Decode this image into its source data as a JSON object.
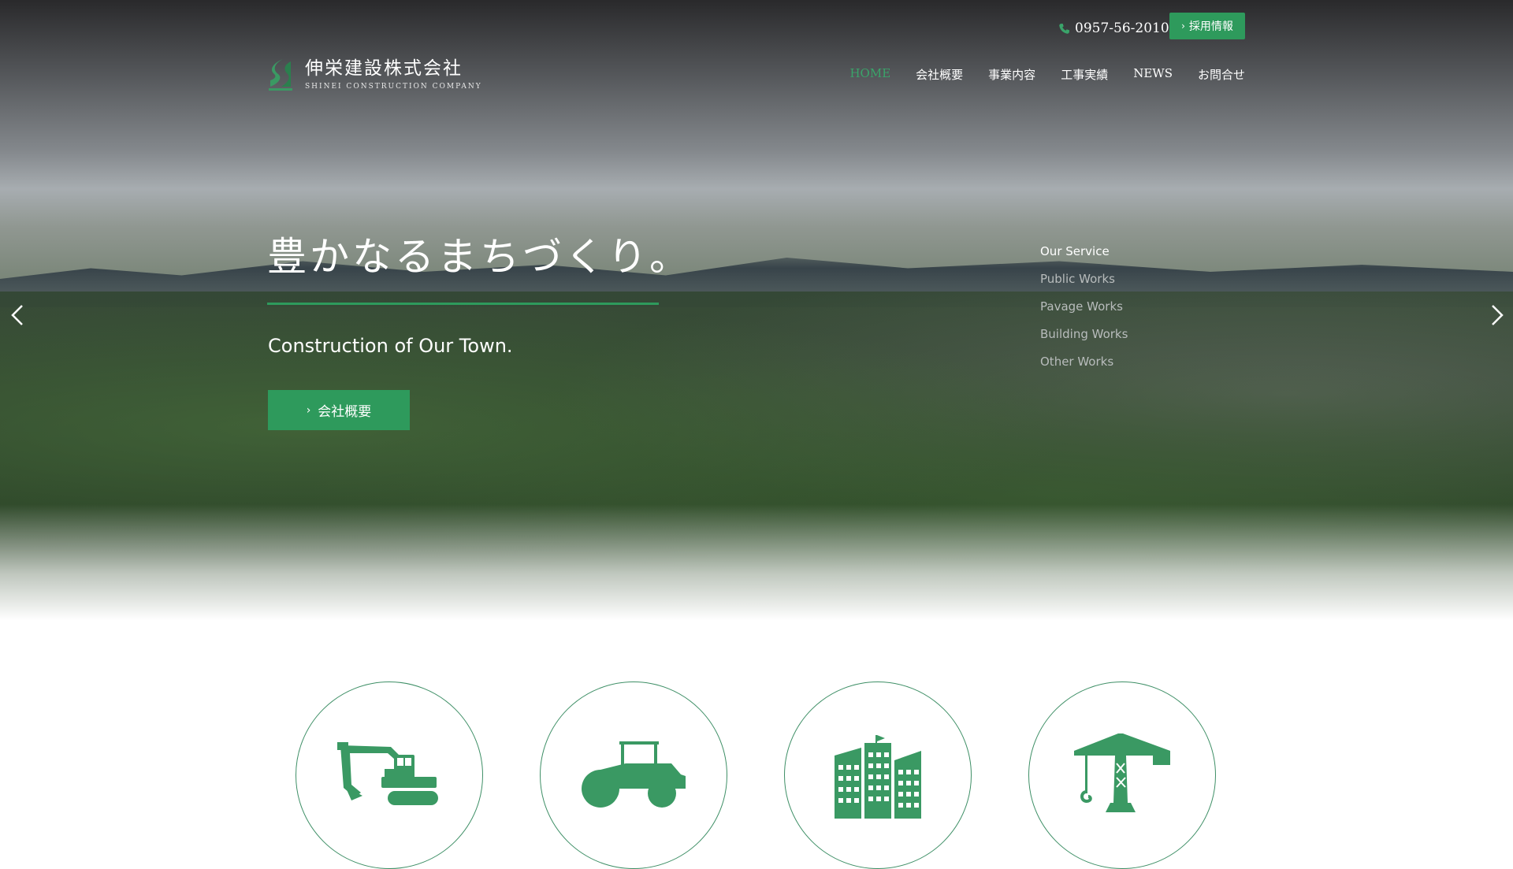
{
  "header": {
    "logo_jp": "伸栄建設株式会社",
    "logo_en": "SHINEI CONSTRUCTION COMPANY",
    "phone": "0957-56-2010",
    "recruit_label": "採用情報"
  },
  "nav": {
    "items": [
      "HOME",
      "会社概要",
      "事業内容",
      "工事実績",
      "NEWS",
      "お問合せ"
    ],
    "active_index": 0
  },
  "hero": {
    "headline": "豊かなるまちづくり。",
    "subheadline": "Construction of Our Town.",
    "cta_label": "会社概要"
  },
  "services": {
    "heading": "Our Service",
    "items": [
      "Public Works",
      "Pavage Works",
      "Building Works",
      "Other Works"
    ]
  },
  "icons": [
    "excavator-icon",
    "road-roller-icon",
    "buildings-icon",
    "tower-crane-icon"
  ],
  "colors": {
    "accent": "#2e9a5c",
    "active_nav": "#3aa46a",
    "icon": "#3a9963"
  }
}
